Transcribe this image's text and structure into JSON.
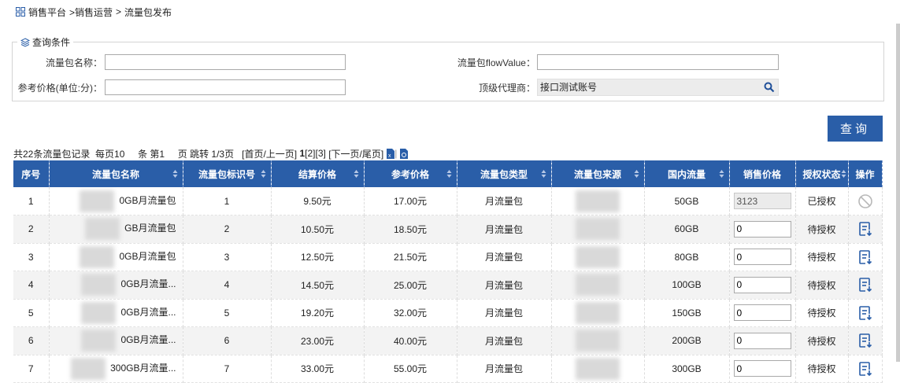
{
  "breadcrumb": {
    "icon": "grid-icon",
    "items": [
      "销售平台",
      ">销售运营",
      ">",
      "流量包发布"
    ]
  },
  "query": {
    "legend": "查询条件",
    "fields": {
      "pkg_name_label": "流量包名称：",
      "pkg_name_value": "",
      "flow_value_label": "流量包flowValue：",
      "flow_value_value": "",
      "ref_price_label": "参考价格(单位:分)：",
      "ref_price_value": "",
      "agent_label": "顶级代理商：",
      "agent_value": "接口测试账号"
    },
    "button": "查询"
  },
  "pager": {
    "total_prefix": "共22条流量包记录",
    "per_page_prefix": "每页10",
    "page_prefix": "条 第1",
    "jump": "页 跳转 1/3页",
    "nav_open": "[首页/上一页]",
    "page_current": "1",
    "page_links": "[2][3]",
    "nav_close": "[下一页/尾页]"
  },
  "table": {
    "columns": [
      "序号",
      "流量包名称",
      "流量包标识号",
      "结算价格",
      "参考价格",
      "流量包类型",
      "流量包来源",
      "国内流量",
      "销售价格",
      "授权状态",
      "操作"
    ],
    "rows": [
      {
        "index": "1",
        "name": "GB月流量包",
        "name_prefix": "0",
        "id": "1",
        "settle": "9.50元",
        "ref": "17.00元",
        "type": "月流量包",
        "flow": "50GB",
        "price": "3123",
        "price_disabled": true,
        "status": "已授权",
        "op_icon": "forbidden-icon"
      },
      {
        "index": "2",
        "name": "GB月流量包",
        "name_prefix": "",
        "id": "2",
        "settle": "10.50元",
        "ref": "18.50元",
        "type": "月流量包",
        "flow": "60GB",
        "price": "0",
        "price_disabled": false,
        "status": "待授权",
        "op_icon": "authorize-icon"
      },
      {
        "index": "3",
        "name": "GB月流量包",
        "name_prefix": "0",
        "id": "3",
        "settle": "12.50元",
        "ref": "21.50元",
        "type": "月流量包",
        "flow": "80GB",
        "price": "0",
        "price_disabled": false,
        "status": "待授权",
        "op_icon": "authorize-icon"
      },
      {
        "index": "4",
        "name": "GB月流量...",
        "name_prefix": "0",
        "id": "4",
        "settle": "14.50元",
        "ref": "25.00元",
        "type": "月流量包",
        "flow": "100GB",
        "price": "0",
        "price_disabled": false,
        "status": "待授权",
        "op_icon": "authorize-icon"
      },
      {
        "index": "5",
        "name": "GB月流量...",
        "name_prefix": "0",
        "id": "5",
        "settle": "19.20元",
        "ref": "32.00元",
        "type": "月流量包",
        "flow": "150GB",
        "price": "0",
        "price_disabled": false,
        "status": "待授权",
        "op_icon": "authorize-icon"
      },
      {
        "index": "6",
        "name": "GB月流量...",
        "name_prefix": "0",
        "id": "6",
        "settle": "23.00元",
        "ref": "40.00元",
        "type": "月流量包",
        "flow": "200GB",
        "price": "0",
        "price_disabled": false,
        "status": "待授权",
        "op_icon": "authorize-icon"
      },
      {
        "index": "7",
        "name": "GB月流量...",
        "name_prefix": "300",
        "id": "7",
        "settle": "33.00元",
        "ref": "55.00元",
        "type": "月流量包",
        "flow": "300GB",
        "price": "0",
        "price_disabled": false,
        "status": "待授权",
        "op_icon": "authorize-icon"
      }
    ]
  },
  "colors": {
    "accent": "#2a5ea8",
    "row_alt": "#f3f3f3"
  }
}
